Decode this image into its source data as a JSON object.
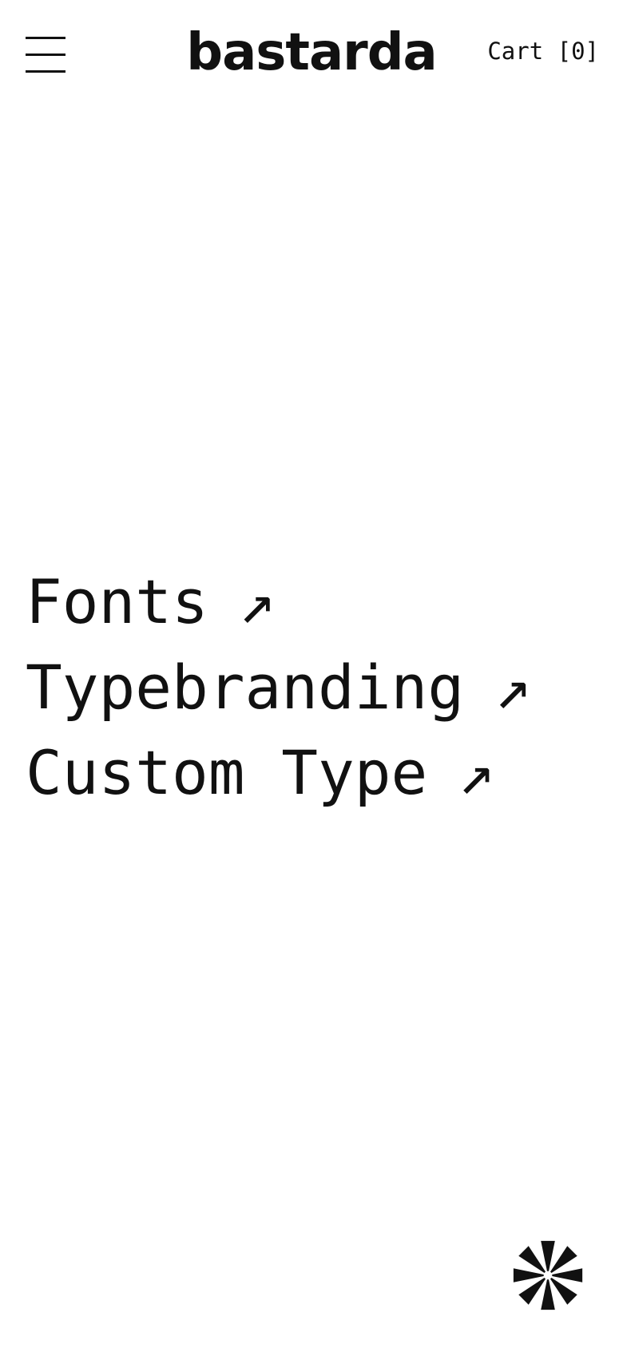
{
  "header": {
    "menu_icon": "hamburger-menu-icon",
    "logo": "bastarda",
    "cart_label": "Cart [0]"
  },
  "nav": {
    "items": [
      {
        "label": "Fonts",
        "arrow": "↗"
      },
      {
        "label": "Typebranding",
        "arrow": "↗"
      },
      {
        "label": "Custom Type",
        "arrow": "↗"
      }
    ]
  },
  "footer": {
    "badge_icon": "asterisk-star-icon"
  },
  "colors": {
    "background": "#ffffff",
    "text": "#111111"
  }
}
